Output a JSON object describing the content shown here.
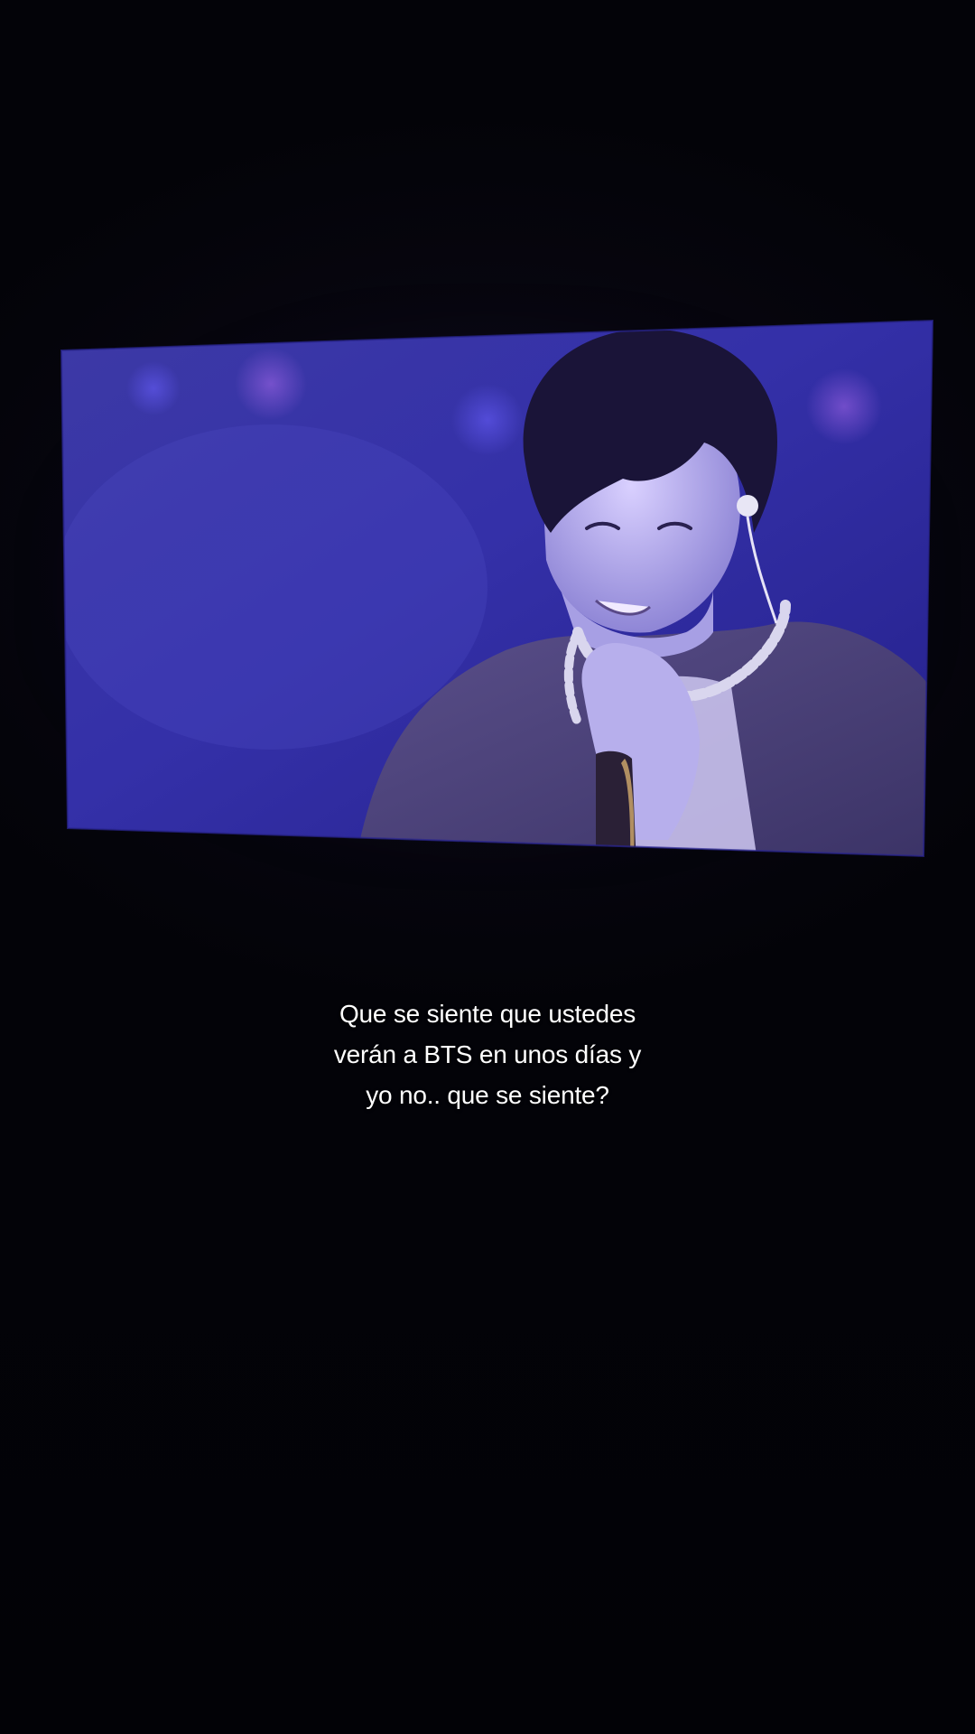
{
  "video_frame": {
    "scene": "concert screen projection",
    "colors": {
      "background": "#05040c",
      "stage_light": "#3a35b8",
      "screen_edge": "#2a2590"
    }
  },
  "caption": {
    "text": "Que se siente que ustedes\nverán a BTS en unos días y\nyo no..  que se siente?"
  }
}
